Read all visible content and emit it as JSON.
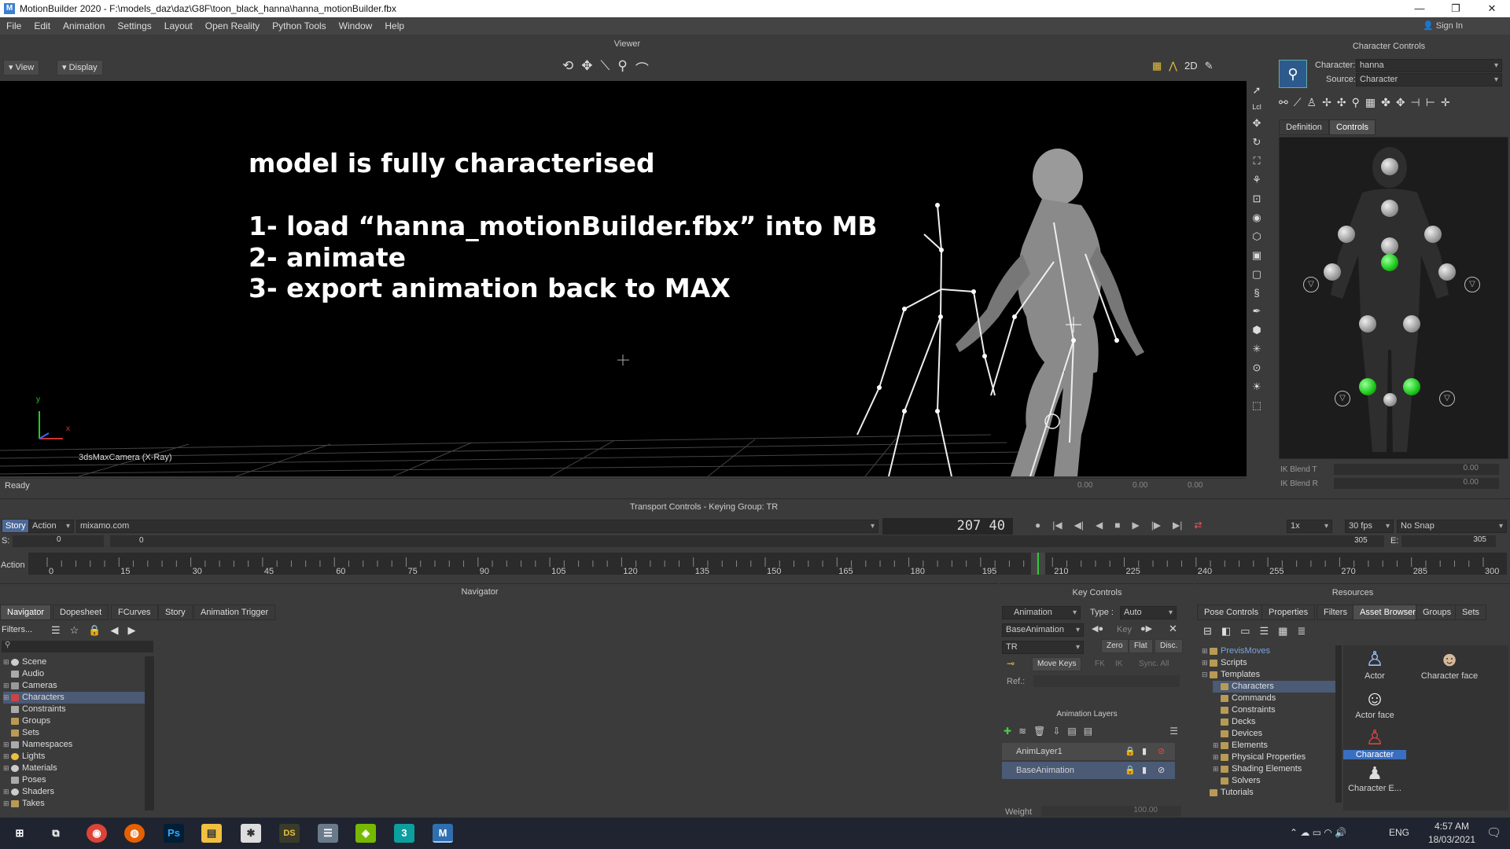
{
  "window": {
    "title": "MotionBuilder 2020   - F:\\models_daz\\daz\\G8F\\toon_black_hanna\\hanna_motionBuilder.fbx",
    "app_letter": "M"
  },
  "menu": [
    "File",
    "Edit",
    "Animation",
    "Settings",
    "Layout",
    "Open Reality",
    "Python Tools",
    "Window",
    "Help"
  ],
  "viewer": {
    "title": "Viewer",
    "view_btn": "View",
    "display_btn": "Display",
    "heading": "model is fully characterised",
    "steps": [
      "1- load “hanna_motionBuilder.fbx” into MB",
      "2- animate",
      "3- export animation back to MAX"
    ],
    "camera_label": "3dsMaxCamera (X-Ray)",
    "axis_y": "y",
    "axis_x": "x",
    "status": "Ready",
    "coords": [
      "0.00",
      "0.00",
      "0.00"
    ]
  },
  "character_controls": {
    "title": "Character Controls",
    "character_label": "Character:",
    "character_value": "hanna",
    "source_label": "Source:",
    "source_value": "Character",
    "tabs": [
      "Definition",
      "Controls"
    ],
    "ik_blend_t": "IK Blend T",
    "ik_blend_r": "IK Blend R",
    "ik_t_value": "0.00",
    "ik_r_value": "0.00"
  },
  "transport": {
    "title": "Transport Controls  -  Keying Group: TR",
    "story_tab": "Story",
    "action_dd": "Action",
    "take": "mixamo.com",
    "frame_display": "207 40",
    "speed": "1x",
    "fps": "30 fps",
    "snap": "No Snap",
    "start_label": "S:",
    "start_value": "0",
    "range_start": "0",
    "range_end": "305",
    "end_label": "E:",
    "end_value": "305",
    "action_label": "Action",
    "ticks": [
      "0",
      "15",
      "30",
      "45",
      "60",
      "75",
      "90",
      "105",
      "120",
      "135",
      "150",
      "165",
      "180",
      "195",
      "210",
      "225",
      "240",
      "255",
      "270",
      "285",
      "300"
    ],
    "current_frame": 207
  },
  "navigator": {
    "title": "Navigator",
    "tabs": [
      "Navigator",
      "Dopesheet",
      "FCurves",
      "Story",
      "Animation Trigger"
    ],
    "filters": "Filters...",
    "items": [
      "Scene",
      "Audio",
      "Cameras",
      "Characters",
      "Constraints",
      "Groups",
      "Sets",
      "Namespaces",
      "Lights",
      "Materials",
      "Poses",
      "Shaders",
      "Takes"
    ]
  },
  "key_controls": {
    "title": "Key Controls",
    "animation_dd": "Animation",
    "type_label": "Type :",
    "type_value": "Auto",
    "layer_dd": "BaseAnimation",
    "key_btn": "Key",
    "tr_dd": "TR",
    "zero": "Zero",
    "flat": "Flat",
    "disc": "Disc.",
    "move_keys": "Move Keys",
    "fk": "FK",
    "ik": "IK",
    "sync": "Sync. All",
    "ref_label": "Ref.:",
    "layers_title": "Animation Layers",
    "layers": [
      "AnimLayer1",
      "BaseAnimation"
    ],
    "weight_label": "Weight",
    "weight_value": "100.00"
  },
  "resources": {
    "title": "Resources",
    "tabs": [
      "Pose Controls",
      "Properties",
      "Filters",
      "Asset Browser",
      "Groups",
      "Sets"
    ],
    "tree": [
      "PrevisMoves",
      "Scripts",
      "Templates",
      "Characters",
      "Commands",
      "Constraints",
      "Decks",
      "Devices",
      "Elements",
      "Physical Properties",
      "Shading Elements",
      "Solvers",
      "Tutorials"
    ],
    "assets": [
      "Actor",
      "Character face",
      "Actor face",
      "Character",
      "Character E..."
    ]
  },
  "taskbar": {
    "lang": "ENG",
    "time": "4:57 AM",
    "date": "18/03/2021",
    "apps": [
      "⊞",
      "⧉",
      "◉",
      "◍",
      "Ps",
      "▤",
      "✱",
      "DS",
      "☰",
      "◈",
      "3",
      "M"
    ]
  },
  "colors": {
    "panel": "#3b3b3b",
    "viewer_bg": "#000000",
    "accent_green": "#33cc33",
    "selection": "#4b5a75"
  }
}
